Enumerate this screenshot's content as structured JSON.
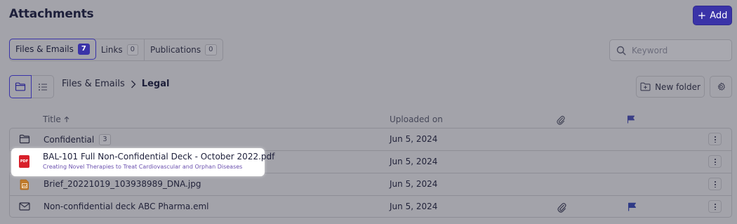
{
  "header": {
    "title": "Attachments",
    "add_label": "Add"
  },
  "tabs": [
    {
      "label": "Files & Emails",
      "count": "7"
    },
    {
      "label": "Links",
      "count": "0"
    },
    {
      "label": "Publications",
      "count": "0"
    }
  ],
  "search": {
    "placeholder": "Keyword"
  },
  "breadcrumb": {
    "root": "Files & Emails",
    "current": "Legal"
  },
  "toolbar": {
    "new_folder_label": "New folder"
  },
  "table": {
    "columns": {
      "title": "Title",
      "uploaded": "Uploaded on"
    },
    "rows": [
      {
        "title": "Confidential",
        "badge": "3",
        "date": "Jun 5, 2024",
        "icon": "folder-icon"
      },
      {
        "title": "BAL-101 Full Non-Confidential Deck - October 2022.pdf",
        "subtitle": "Creating Novel Therapies to Treat Cardiovascular and Orphan Diseases",
        "date": "Jun 5, 2024",
        "icon": "pdf-icon",
        "icon_text": "PDF"
      },
      {
        "title": "Brief_20221019_103938989_DNA.jpg",
        "date": "Jun 5, 2024",
        "icon": "image-file-icon"
      },
      {
        "title": "Non-confidential deck ABC Pharma.eml",
        "date": "Jun 5, 2024",
        "icon": "email-icon",
        "has_attachment": true,
        "flagged": true
      }
    ]
  },
  "colors": {
    "accent": "#3a33a8",
    "pdf": "#d8202a",
    "image_file": "#c07a2a",
    "overlay": "#a3a3aa"
  }
}
